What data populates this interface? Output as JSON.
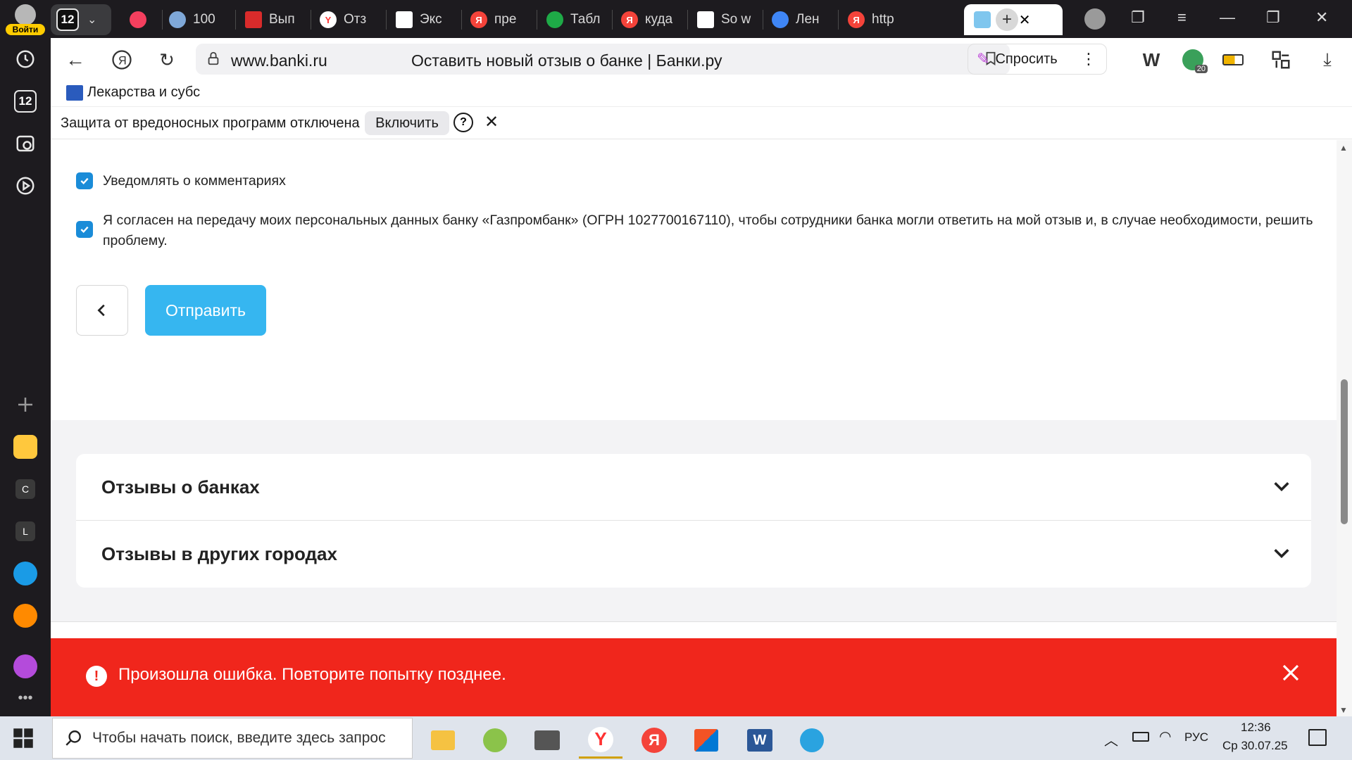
{
  "browser": {
    "login_label": "Войти",
    "tab_counter": "12",
    "tabs": [
      {
        "label": "100"
      },
      {
        "label": "Вып"
      },
      {
        "label": "Отз"
      },
      {
        "label": "Экс"
      },
      {
        "label": "пре"
      },
      {
        "label": "Табл"
      },
      {
        "label": "куда"
      },
      {
        "label": "So w"
      },
      {
        "label": "Лен"
      },
      {
        "label": "http"
      }
    ],
    "active_tab": "С",
    "address": {
      "domain": "www.banki.ru",
      "page_title": "Оставить новый отзыв о банке | Банки.ру"
    },
    "ask_label": "Спросить",
    "shield_count": "20",
    "bookmark": {
      "label": "Лекарства и субс"
    },
    "infobar": {
      "text": "Защита от вредоносных программ отключена",
      "enable_label": "Включить",
      "help_label": "?"
    },
    "rail_letters": [
      "C",
      "L"
    ],
    "rail_badge": "12"
  },
  "form": {
    "notify_comments": {
      "label": "Уведомлять о комментариях",
      "checked": true
    },
    "consent": {
      "label": "Я согласен на передачу моих персональных данных банку «Газпромбанк» (ОГРН 1027700167110), чтобы сотрудники банка могли ответить на мой отзыв и, в случае необходимости, решить проблему.",
      "checked": true
    },
    "submit_label": "Отправить"
  },
  "accordion": [
    {
      "label": "Отзывы о банках"
    },
    {
      "label": "Отзывы в других городах"
    }
  ],
  "error": {
    "message": "Произошла ошибка. Повторите попытку позднее."
  },
  "taskbar": {
    "search_placeholder": "Чтобы начать поиск, введите здесь запрос",
    "language": "РУС",
    "time": "12:36",
    "date": "Ср 30.07.25"
  },
  "colors": {
    "accent_blue": "#36b6f0",
    "checkbox_blue": "#1a8cd8",
    "error_red": "#f0261c",
    "browser_dark": "#1d1b1f"
  }
}
